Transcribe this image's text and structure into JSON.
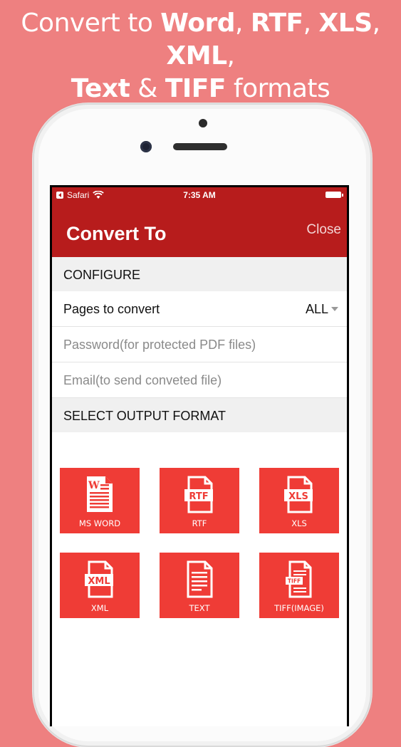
{
  "promo": {
    "line1_prefix": "Convert to ",
    "word": "Word",
    "comma1": ", ",
    "rtf": "RTF",
    "comma2": ", ",
    "xls": "XLS",
    "comma3": ", ",
    "xml": "XML",
    "comma4": ",",
    "text": "Text",
    "amp": " & ",
    "tiff": "TIFF",
    "suffix": " formats"
  },
  "status_bar": {
    "back_app": "Safari",
    "time": "7:35 AM"
  },
  "nav": {
    "title": "Convert To",
    "close_label": "Close"
  },
  "configure": {
    "header": "CONFIGURE",
    "pages_label": "Pages to convert",
    "pages_value": "ALL",
    "password_placeholder": "Password(for protected PDF files)",
    "email_placeholder": "Email(to send conveted file)"
  },
  "output": {
    "header": "SELECT OUTPUT FORMAT",
    "formats": [
      {
        "label": "MS WORD",
        "icon": "word-doc-icon"
      },
      {
        "label": "RTF",
        "icon": "rtf-file-icon"
      },
      {
        "label": "XLS",
        "icon": "xls-file-icon"
      },
      {
        "label": "XML",
        "icon": "xml-file-icon"
      },
      {
        "label": "TEXT",
        "icon": "text-file-icon"
      },
      {
        "label": "TIFF(IMAGE)",
        "icon": "tiff-file-icon"
      }
    ]
  },
  "colors": {
    "background": "#ee8080",
    "nav_red": "#b71c1c",
    "tile_red": "#ef3c36"
  }
}
